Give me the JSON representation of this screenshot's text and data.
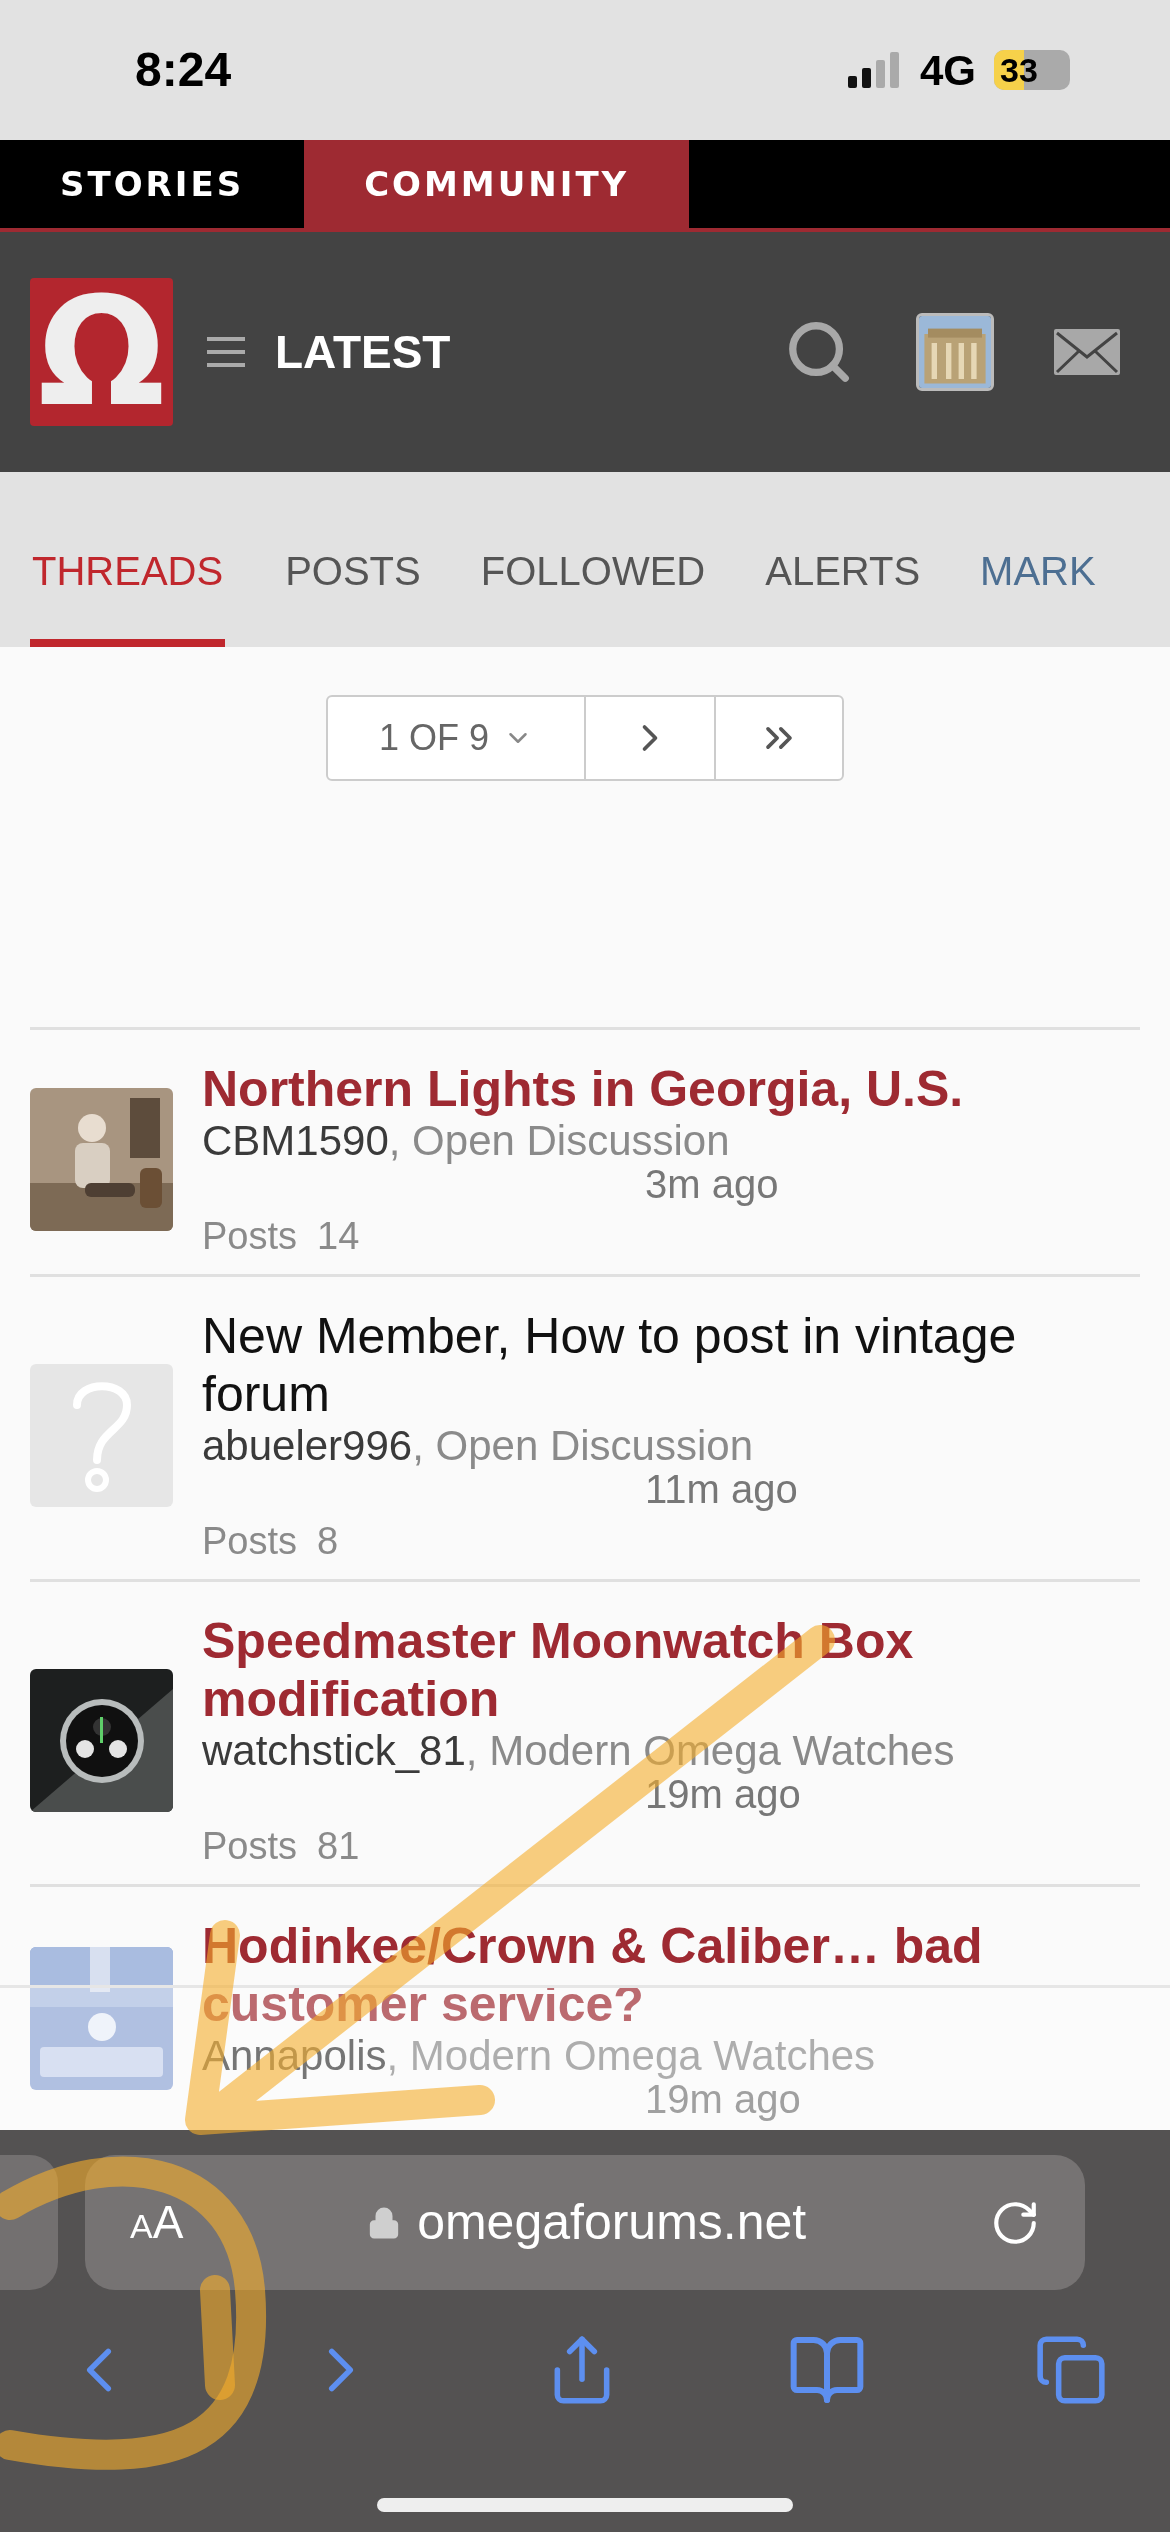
{
  "status_bar": {
    "time": "8:24",
    "network": "4G",
    "battery": "33"
  },
  "top_nav": [
    {
      "label": "STORIES",
      "selected": false
    },
    {
      "label": "COMMUNITY",
      "selected": true
    }
  ],
  "header": {
    "logo": "Ω",
    "title": "LATEST"
  },
  "tabs": [
    {
      "label": "THREADS",
      "selected": true,
      "kind": "tab"
    },
    {
      "label": "POSTS",
      "selected": false,
      "kind": "tab"
    },
    {
      "label": "FOLLOWED",
      "selected": false,
      "kind": "tab"
    },
    {
      "label": "ALERTS",
      "selected": false,
      "kind": "tab"
    },
    {
      "label": "MARK",
      "selected": false,
      "kind": "action"
    }
  ],
  "pagination": {
    "page": "1 OF 9"
  },
  "threads": [
    {
      "title": "Northern Lights in Georgia, U.S.",
      "unread": true,
      "author": "CBM1590",
      "separator": ",",
      "forum": "Open Discussion",
      "time": "3m ago",
      "posts_label": "Posts",
      "posts": "14"
    },
    {
      "title": "New Member, How to post in vintage forum",
      "unread": false,
      "avatar": {
        "kind": "placeholder"
      },
      "author": "abueler996",
      "separator": ",",
      "forum": "Open Discussion",
      "time": "11m ago",
      "posts_label": "Posts",
      "posts": "8"
    },
    {
      "title": "Speedmaster Moonwatch Box modification",
      "unread": true,
      "author": "watchstick_81",
      "separator": ",",
      "forum": "Modern Omega Watches",
      "time": "19m ago",
      "posts_label": "Posts",
      "posts": "81"
    },
    {
      "title": "Hodinkee/Crown & Caliber… bad customer service?",
      "unread": true,
      "author": "Annapolis",
      "separator": ",",
      "forum": "Modern Omega Watches",
      "time": "19m ago"
    }
  ],
  "browser": {
    "text_size": "AA",
    "url": "omegaforums.net"
  }
}
